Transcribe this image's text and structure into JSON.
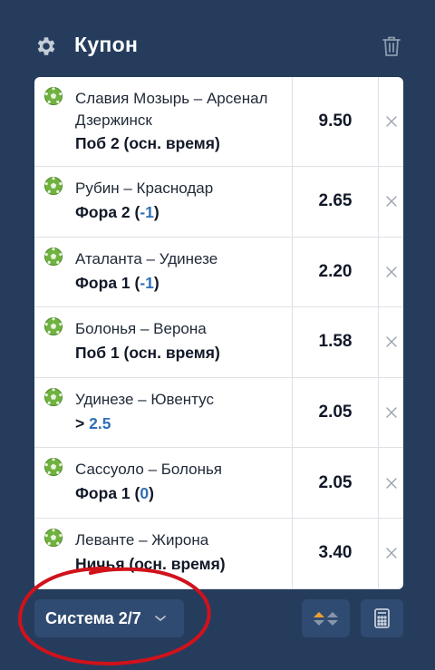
{
  "header": {
    "title": "Купон",
    "settings_icon": "gear-icon",
    "delete_icon": "trash-icon"
  },
  "bets": [
    {
      "match": "Славия Мозырь – Арсенал Дзержинск",
      "pick_parts": [
        "Поб 2 (осн. время)"
      ],
      "odds": "9.50"
    },
    {
      "match": "Рубин – Краснодар",
      "pick_parts": [
        "Фора 2 (",
        "-1",
        ")"
      ],
      "odds": "2.65"
    },
    {
      "match": "Аталанта – Удинезе",
      "pick_parts": [
        "Фора 1 (",
        "-1",
        ")"
      ],
      "odds": "2.20"
    },
    {
      "match": "Болонья – Верона",
      "pick_parts": [
        "Поб 1 (осн. время)"
      ],
      "odds": "1.58"
    },
    {
      "match": "Удинезе – Ювентус",
      "pick_parts": [
        "> ",
        "2.5",
        ""
      ],
      "odds": "2.05"
    },
    {
      "match": "Сассуоло – Болонья",
      "pick_parts": [
        "Фора 1 (",
        "0",
        ")"
      ],
      "odds": "2.05"
    },
    {
      "match": "Леванте – Жирона",
      "pick_parts": [
        "Ничья (осн. время)"
      ],
      "odds": "3.40"
    }
  ],
  "footer": {
    "system_label": "Система 2/7",
    "sort_icon": "sort-arrows-icon",
    "calculator_icon": "calculator-icon"
  },
  "colors": {
    "background": "#253c5d",
    "button": "#304b71",
    "accent_blue": "#2f6fb8",
    "annotation_red": "#d0121b",
    "sort_up": "#f0a030"
  }
}
